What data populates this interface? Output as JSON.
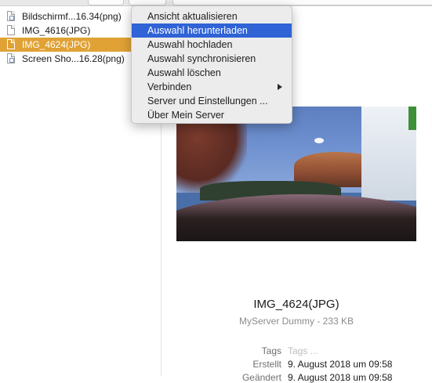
{
  "files": [
    {
      "name": "Bildschirmf...16.34(png)",
      "type": "png",
      "selected": false
    },
    {
      "name": "IMG_4616(JPG)",
      "type": "jpg",
      "selected": false
    },
    {
      "name": "IMG_4624(JPG)",
      "type": "jpg",
      "selected": true
    },
    {
      "name": "Screen Sho...16.28(png)",
      "type": "png",
      "selected": false
    }
  ],
  "menu": {
    "items": [
      {
        "label": "Ansicht aktualisieren"
      },
      {
        "label": "Auswahl herunterladen",
        "highlighted": true
      },
      {
        "label": "Auswahl hochladen"
      },
      {
        "label": "Auswahl synchronisieren"
      },
      {
        "label": "Auswahl löschen"
      },
      {
        "label": "Verbinden",
        "submenu": true
      },
      {
        "label": "Server und Einstellungen ..."
      },
      {
        "label": "Über Mein Server"
      }
    ]
  },
  "preview": {
    "filename": "IMG_4624(JPG)",
    "subtitle": "MyServer Dummy - 233 KB"
  },
  "meta": {
    "tags_label": "Tags",
    "tags_placeholder": "Tags ...",
    "created_label": "Erstellt",
    "created_value": "9. August 2018 um 09:58",
    "modified_label": "Geändert",
    "modified_value": "9. August 2018 um 09:58"
  },
  "colors": {
    "selection": "#e0a235",
    "menu_highlight": "#2f63d6"
  }
}
